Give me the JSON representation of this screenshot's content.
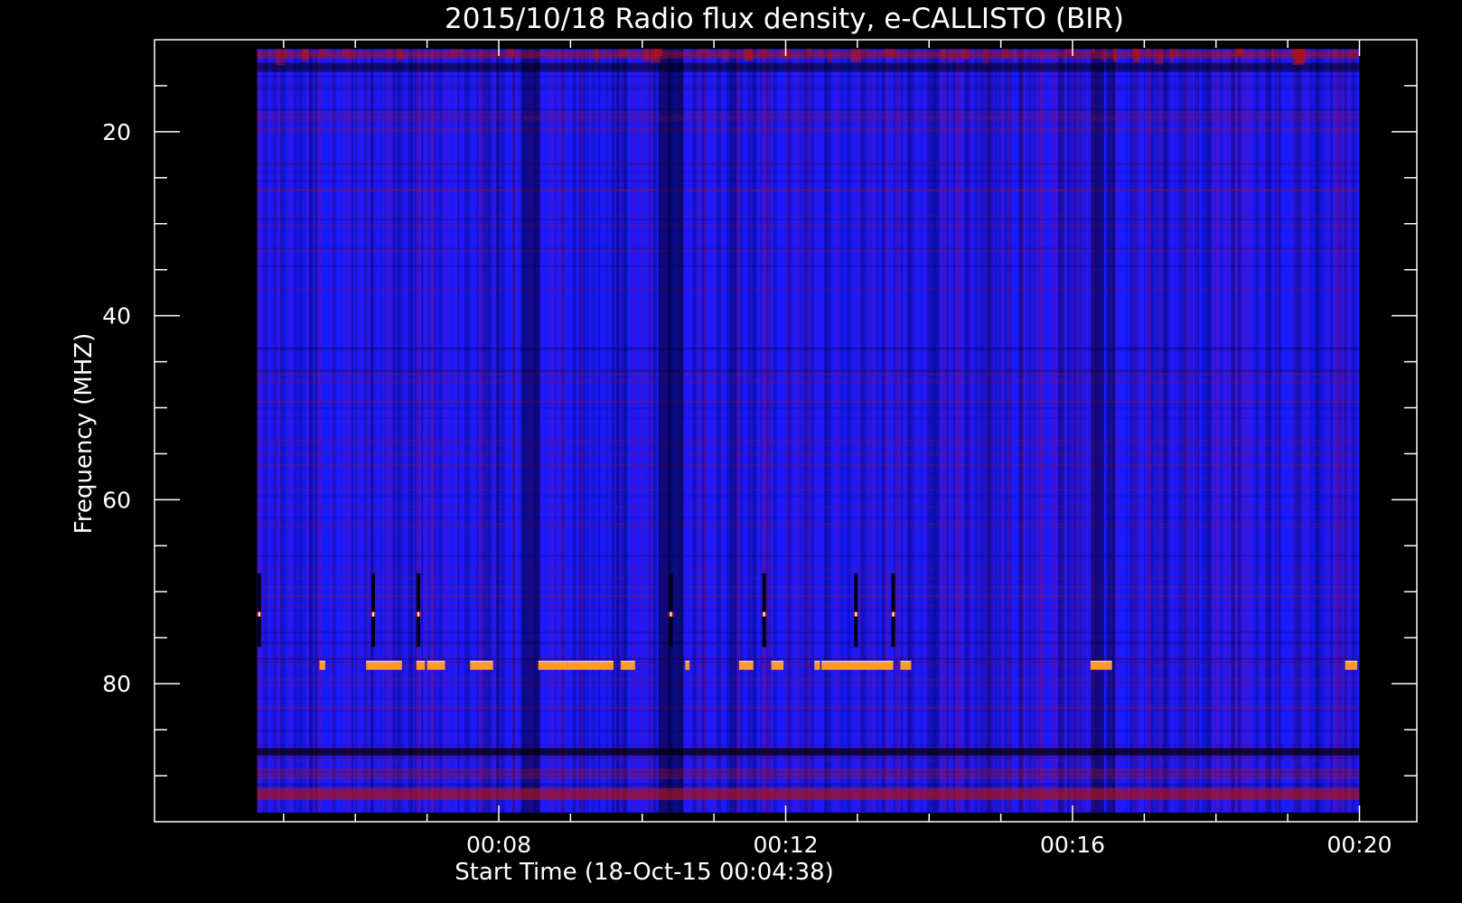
{
  "chart_data": {
    "type": "heatmap",
    "title": "2015/10/18  Radio flux density, e-CALLISTO (BIR)",
    "xlabel": "Start Time (18-Oct-15 00:04:38)",
    "ylabel": "Frequency (MHZ)",
    "x_unit": "minutes after 00:00 UT",
    "xlim": [
      3.2,
      20.8
    ],
    "ylim": [
      95,
      10
    ],
    "data_extent": {
      "x": [
        4.63,
        20.0
      ],
      "y": [
        11,
        94
      ]
    },
    "x_ticks": [
      {
        "value": 8,
        "label": "00:08"
      },
      {
        "value": 12,
        "label": "00:12"
      },
      {
        "value": 16,
        "label": "00:16"
      },
      {
        "value": 20,
        "label": "00:20"
      }
    ],
    "x_minor_ticks": [
      5,
      6,
      7,
      9,
      10,
      11,
      13,
      14,
      15,
      17,
      18,
      19
    ],
    "y_ticks": [
      {
        "value": 20,
        "label": "20"
      },
      {
        "value": 40,
        "label": "40"
      },
      {
        "value": 60,
        "label": "60"
      },
      {
        "value": 80,
        "label": "80"
      }
    ],
    "y_minor_ticks": [
      15,
      25,
      30,
      35,
      45,
      50,
      55,
      65,
      70,
      75,
      85,
      90
    ],
    "colors": {
      "background": "#000000",
      "axes": "#ffffff",
      "field": "#1a1aff",
      "field_warm": "#5a12b8",
      "red": "#b01414",
      "orange": "#ff9a2a",
      "highlight": "#ffd070"
    },
    "dark_columns": [
      {
        "x": 8.45,
        "w": 0.25,
        "strength": 0.7
      },
      {
        "x": 10.4,
        "w": 0.35,
        "strength": 0.85
      },
      {
        "x": 11.25,
        "w": 0.15,
        "strength": 0.35
      },
      {
        "x": 16.35,
        "w": 0.18,
        "strength": 0.75
      },
      {
        "x": 16.55,
        "w": 0.1,
        "strength": 0.5
      },
      {
        "x": 14.8,
        "w": 0.2,
        "strength": 0.3
      }
    ],
    "horizontal_bands": [
      {
        "y": 11.6,
        "h": 0.9,
        "color": "red",
        "alpha": 0.45
      },
      {
        "y": 13,
        "h": 1.0,
        "color": "black",
        "alpha": 0.5
      },
      {
        "y": 18.5,
        "h": 0.6,
        "color": "red",
        "alpha": 0.2
      },
      {
        "y": 87.4,
        "h": 0.8,
        "color": "black",
        "alpha": 0.7
      },
      {
        "y": 89.8,
        "h": 1.2,
        "color": "red",
        "alpha": 0.3
      },
      {
        "y": 92.0,
        "h": 1.3,
        "color": "red",
        "alpha": 0.65
      }
    ],
    "bursts_78mhz": [
      {
        "x0": 5.5,
        "x1": 5.58
      },
      {
        "x0": 6.15,
        "x1": 6.65
      },
      {
        "x0": 6.85,
        "x1": 6.97
      },
      {
        "x0": 7.0,
        "x1": 7.25
      },
      {
        "x0": 7.6,
        "x1": 7.92
      },
      {
        "x0": 8.55,
        "x1": 8.95
      },
      {
        "x0": 8.95,
        "x1": 9.6
      },
      {
        "x0": 9.7,
        "x1": 9.9
      },
      {
        "x0": 10.6,
        "x1": 10.66
      },
      {
        "x0": 11.35,
        "x1": 11.55
      },
      {
        "x0": 11.8,
        "x1": 11.97
      },
      {
        "x0": 12.4,
        "x1": 12.48
      },
      {
        "x0": 12.5,
        "x1": 13.5
      },
      {
        "x0": 13.6,
        "x1": 13.75
      },
      {
        "x0": 16.25,
        "x1": 16.55
      },
      {
        "x0": 19.8,
        "x1": 19.97
      }
    ],
    "spikes_72mhz": [
      4.66,
      6.25,
      6.88,
      10.4,
      11.7,
      12.98,
      13.5
    ]
  }
}
